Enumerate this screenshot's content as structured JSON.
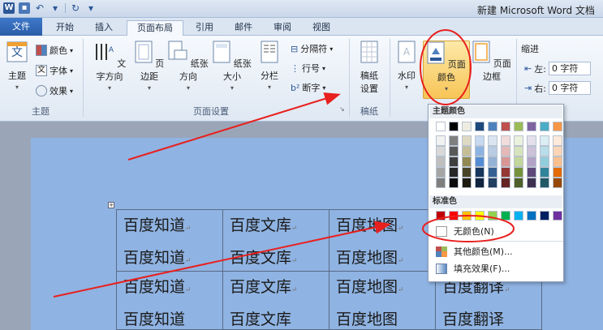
{
  "window": {
    "title": "新建 Microsoft Word 文档",
    "app_icon": "word-icon"
  },
  "tabs": [
    {
      "label": "文件",
      "active": false
    },
    {
      "label": "开始",
      "active": false
    },
    {
      "label": "插入",
      "active": false
    },
    {
      "label": "页面布局",
      "active": true
    },
    {
      "label": "引用",
      "active": false
    },
    {
      "label": "邮件",
      "active": false
    },
    {
      "label": "审阅",
      "active": false
    },
    {
      "label": "视图",
      "active": false
    }
  ],
  "ribbon": {
    "theme_group": {
      "label": "主题",
      "theme_button": "主题",
      "colors": "颜色",
      "fonts": "字体",
      "effects": "效果"
    },
    "page_setup_group": {
      "label": "页面设置",
      "text_direction": "文字方向",
      "margins": "页边距",
      "orientation": "纸张方向",
      "size": "纸张大小",
      "columns": "分栏",
      "breaks": "分隔符",
      "line_numbers": "行号",
      "hyphenation": "断字"
    },
    "manuscript_group": {
      "label": "稿纸",
      "manuscript_settings_line1": "稿纸",
      "manuscript_settings_line2": "设置"
    },
    "page_background_group": {
      "watermark": "水印",
      "page_color": "页面颜色",
      "page_borders": "页面边框"
    },
    "paragraph_group": {
      "indent_label": "缩进",
      "left_label": "左:",
      "left_value": "0 字符",
      "right_label": "右:",
      "right_value": "0 字符"
    }
  },
  "page_color_dropdown": {
    "theme_colors_header": "主题颜色",
    "standard_colors_header": "标准色",
    "no_color": "无颜色(N)",
    "more_colors": "其他颜色(M)...",
    "fill_effects": "填充效果(F)...",
    "theme_colors": [
      "#ffffff",
      "#000000",
      "#eeece1",
      "#1f497d",
      "#4f81bd",
      "#c0504d",
      "#9bbb59",
      "#8064a2",
      "#4bacc6",
      "#f79646"
    ],
    "theme_shades": [
      [
        "#f2f2f2",
        "#7f7f7f",
        "#ddd9c3",
        "#c6d9f0",
        "#dbe5f1",
        "#f2dcdb",
        "#ebf1dd",
        "#e5e0ec",
        "#dbeef3",
        "#fdeada"
      ],
      [
        "#d8d8d8",
        "#595959",
        "#c4bd97",
        "#8db3e2",
        "#b8cce4",
        "#e5b9b7",
        "#d7e3bc",
        "#ccc1d9",
        "#b7dde8",
        "#fbd5b5"
      ],
      [
        "#bfbfbf",
        "#3f3f3f",
        "#938953",
        "#548dd4",
        "#95b3d7",
        "#d99694",
        "#c3d69b",
        "#b2a2c7",
        "#92cddc",
        "#fac08f"
      ],
      [
        "#a5a5a5",
        "#262626",
        "#494429",
        "#17365d",
        "#366092",
        "#953734",
        "#76923c",
        "#5f497a",
        "#31859b",
        "#e36c09"
      ],
      [
        "#7f7f7f",
        "#0c0c0c",
        "#1d1b10",
        "#0f243e",
        "#244061",
        "#632423",
        "#4f6128",
        "#3f3151",
        "#205867",
        "#974806"
      ]
    ],
    "standard_colors": [
      "#c00000",
      "#ff0000",
      "#ffc000",
      "#ffff00",
      "#92d050",
      "#00b050",
      "#00b0f0",
      "#0070c0",
      "#002060",
      "#7030a0"
    ]
  },
  "document": {
    "page_color": "#8fb3e2",
    "table_rows": [
      [
        "百度知道",
        "百度文库",
        "百度地图",
        ""
      ],
      [
        "百度知道",
        "百度文库",
        "百度地图",
        "百度翻译"
      ]
    ],
    "table_rows_line2": [
      [
        "百度知道",
        "百度文库",
        "百度地图",
        ""
      ],
      [
        "百度知道",
        "百度文库",
        "百度地图",
        "百度翻译"
      ]
    ]
  },
  "annotation_color": "#e8201e"
}
